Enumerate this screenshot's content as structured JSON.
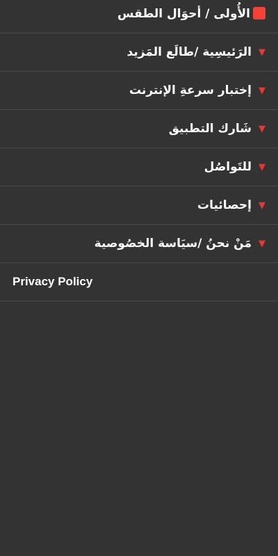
{
  "menu": {
    "items": [
      {
        "label": "الأُولى / أحوَال الطقس",
        "bullet": "red-square-icon"
      },
      {
        "label": "الرَئيسِية /طالَع المَزيد",
        "bullet": "red-triangle-icon"
      },
      {
        "label": "إختبار سرعةِ الإنترنت",
        "bullet": "red-triangle-icon"
      },
      {
        "label": "شَارك التطبيق",
        "bullet": "red-triangle-icon"
      },
      {
        "label": "للتَواصُل",
        "bullet": "red-triangle-icon"
      },
      {
        "label": "إحصائيات",
        "bullet": "red-triangle-icon"
      },
      {
        "label": "مَنْ نحنُ /سيَاسة الخصُوصية",
        "bullet": "red-triangle-icon"
      },
      {
        "label": "Privacy Policy"
      }
    ]
  },
  "colors": {
    "background": "#333333",
    "text": "#ffffff",
    "accent": "#e53935",
    "divider": "#4a4a4a"
  }
}
